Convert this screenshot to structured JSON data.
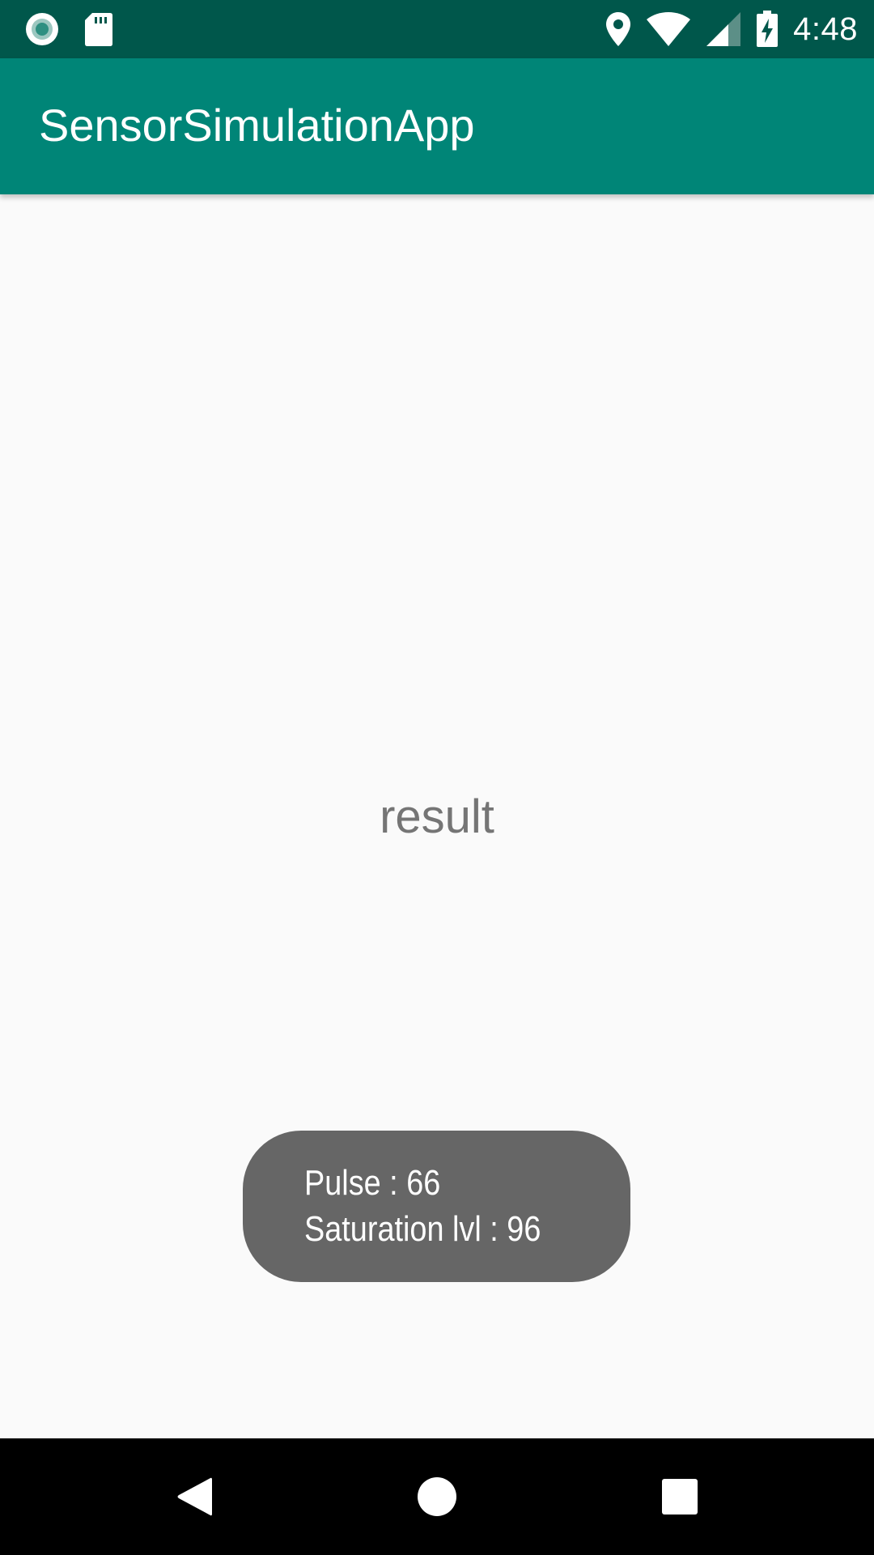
{
  "status_bar": {
    "time": "4:48",
    "left_icons": [
      "record-icon",
      "sd-card-icon"
    ],
    "right_icons": [
      "location-icon",
      "wifi-icon",
      "cell-signal-icon",
      "battery-charging-icon"
    ]
  },
  "app_bar": {
    "title": "SensorSimulationApp"
  },
  "main": {
    "result_text": "result"
  },
  "toast": {
    "line1": "Pulse : 66",
    "line2": "Saturation lvl : 96"
  },
  "nav_bar": {
    "buttons": [
      "back-icon",
      "home-icon",
      "recents-icon"
    ]
  },
  "colors": {
    "status_bar": "#00574b",
    "app_bar": "#008577",
    "background": "#fafafa",
    "result_text": "#757575",
    "toast_bg": "#666666",
    "nav_bar": "#000000"
  }
}
